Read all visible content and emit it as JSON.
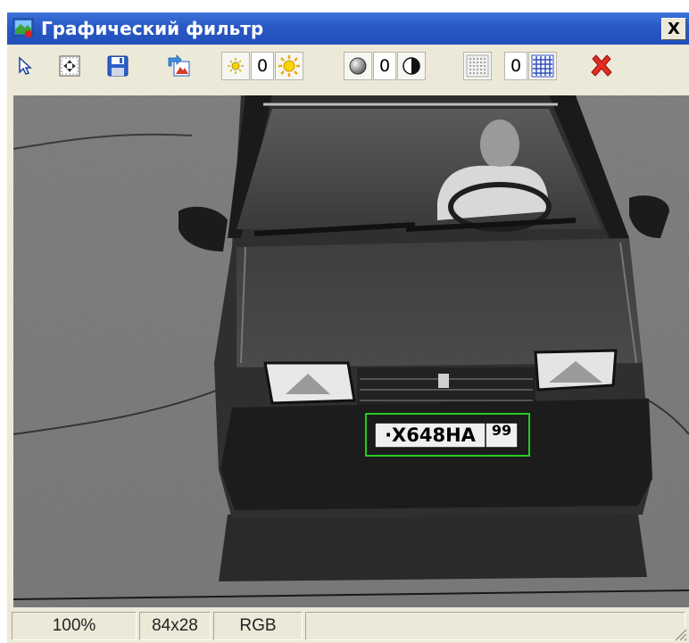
{
  "window": {
    "title": "Графический фильтр",
    "close_label": "X"
  },
  "toolbar": {
    "items": [
      {
        "id": "pointer",
        "icon": "pointer-arrow-icon"
      },
      {
        "id": "fit",
        "icon": "fit-to-window-icon"
      },
      {
        "id": "save",
        "icon": "save-disk-icon"
      },
      {
        "id": "export",
        "icon": "export-image-icon"
      }
    ],
    "brightness": {
      "value": "0",
      "decrease_icon": "brightness-decrease-icon",
      "increase_icon": "brightness-increase-icon"
    },
    "contrast": {
      "value": "0",
      "decrease_icon": "contrast-decrease-icon",
      "increase_icon": "contrast-increase-icon"
    },
    "sharpness": {
      "value": "0",
      "decrease_icon": "sharpness-decrease-icon",
      "increase_icon": "sharpness-increase-icon"
    },
    "reset_icon": "red-x-reset-icon"
  },
  "image": {
    "plate_text": "·X648НА",
    "plate_region": "99",
    "colors": {
      "plate_frame": "#22cc22",
      "reset_red": "#e52b1f"
    }
  },
  "status": {
    "zoom": "100%",
    "size": "84x28",
    "color_mode": "RGB"
  }
}
